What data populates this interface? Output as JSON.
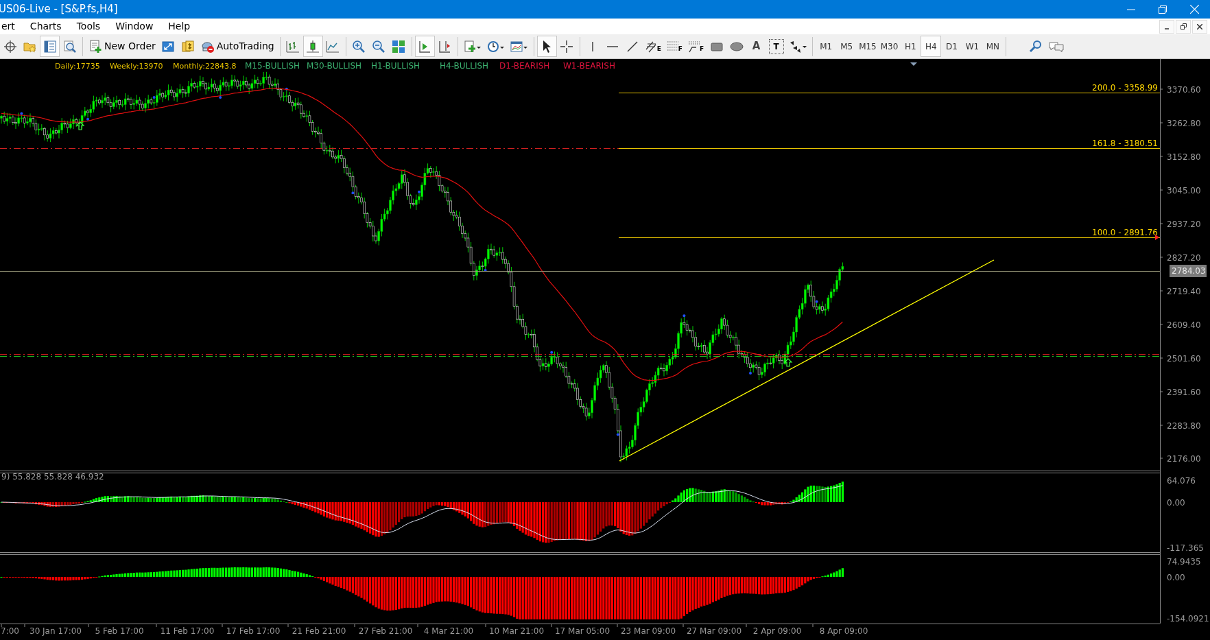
{
  "window": {
    "title": "US06-Live - [S&P.fs,H4]"
  },
  "menu": [
    {
      "label": "ert"
    },
    {
      "label": "Charts"
    },
    {
      "label": "Tools"
    },
    {
      "label": "Window"
    },
    {
      "label": "Help"
    }
  ],
  "toolbar": [
    {
      "kind": "target",
      "pressed": false
    },
    {
      "kind": "folder",
      "pressed": false
    },
    {
      "kind": "navigator",
      "pressed": true
    },
    {
      "kind": "history",
      "pressed": false
    },
    {
      "kind": "sep"
    },
    {
      "kind": "new-order",
      "label": "New Order",
      "pressed": false
    },
    {
      "kind": "expand",
      "pressed": false
    },
    {
      "kind": "coins",
      "pressed": false
    },
    {
      "kind": "autotrading",
      "label": "AutoTrading",
      "pressed": false
    },
    {
      "kind": "sep"
    },
    {
      "kind": "bars",
      "pressed": false
    },
    {
      "kind": "candles",
      "pressed": true
    },
    {
      "kind": "line",
      "pressed": false
    },
    {
      "kind": "sep"
    },
    {
      "kind": "zoom-in",
      "pressed": false
    },
    {
      "kind": "zoom-out",
      "pressed": false
    },
    {
      "kind": "tile",
      "pressed": false
    },
    {
      "kind": "sep"
    },
    {
      "kind": "autoscroll",
      "pressed": true
    },
    {
      "kind": "shift",
      "pressed": false
    },
    {
      "kind": "sep"
    },
    {
      "kind": "indicators",
      "pressed": false
    },
    {
      "kind": "clock",
      "pressed": false
    },
    {
      "kind": "template",
      "pressed": false
    },
    {
      "kind": "sep"
    },
    {
      "kind": "cursor",
      "pressed": true
    },
    {
      "kind": "crosshair",
      "pressed": false
    },
    {
      "kind": "sep"
    },
    {
      "kind": "vline",
      "pressed": false
    },
    {
      "kind": "hline",
      "pressed": false
    },
    {
      "kind": "trendline",
      "pressed": false
    },
    {
      "kind": "channel",
      "label": "E",
      "pressed": false
    },
    {
      "kind": "fib",
      "label": "F",
      "pressed": false
    },
    {
      "kind": "fibfan",
      "label": "F",
      "pressed": false
    },
    {
      "kind": "rect",
      "pressed": false
    },
    {
      "kind": "ellipse",
      "pressed": false
    },
    {
      "kind": "text",
      "label": "A",
      "pressed": false
    },
    {
      "kind": "textlabel",
      "label": "T",
      "pressed": false
    },
    {
      "kind": "arrows",
      "pressed": false
    },
    {
      "kind": "sep"
    }
  ],
  "timeframes": [
    {
      "label": "M1",
      "selected": false
    },
    {
      "label": "M5",
      "selected": false
    },
    {
      "label": "M15",
      "selected": false
    },
    {
      "label": "M30",
      "selected": false
    },
    {
      "label": "H1",
      "selected": false
    },
    {
      "label": "H4",
      "selected": true
    },
    {
      "label": "D1",
      "selected": false
    },
    {
      "label": "W1",
      "selected": false
    },
    {
      "label": "MN",
      "selected": false
    }
  ],
  "chart": {
    "info": [
      {
        "text": "Daily:17735"
      },
      {
        "text": "Weekly:13970"
      },
      {
        "text": "Monthly:22843.8"
      }
    ],
    "trends": [
      {
        "text": "M15-BULLISH",
        "color": "#3cb371"
      },
      {
        "text": "M30-BULLISH",
        "color": "#3cb371"
      },
      {
        "text": "H1-BULLISH",
        "color": "#3cb371"
      },
      {
        "text": "H4-BULLISH",
        "color": "#3cb371"
      },
      {
        "text": "D1-BEARISH",
        "color": "#dc143c"
      },
      {
        "text": "W1-BEARISH",
        "color": "#dc143c"
      }
    ],
    "fib_levels": [
      {
        "label": "200.0 - 3358.99"
      },
      {
        "label": "161.8 - 3180.51"
      },
      {
        "label": "100.0 - 2891.76"
      }
    ],
    "price_axis": [
      "3370.60",
      "3262.80",
      "3152.80",
      "3045.00",
      "2937.20",
      "2827.20",
      "2719.40",
      "2609.40",
      "2501.60",
      "2391.60",
      "2283.80",
      "2176.00"
    ],
    "current_price": "2784.03",
    "indicator_1": {
      "label": "9) 55.828 55.828 46.932",
      "axis": [
        "64.076",
        "0.00",
        "-117.365"
      ]
    },
    "indicator_2": {
      "axis": [
        "74.9435",
        "0.00",
        "-154.0921"
      ]
    },
    "time_axis": [
      "7:00",
      "30 Jan 17:00",
      "5 Feb 17:00",
      "11 Feb 17:00",
      "17 Feb 17:00",
      "21 Feb 21:00",
      "27 Feb 21:00",
      "4 Mar 21:00",
      "10 Mar 21:00",
      "17 Mar 05:00",
      "23 Mar 09:00",
      "27 Mar 09:00",
      "2 Apr 09:00",
      "8 Apr 09:00"
    ]
  }
}
